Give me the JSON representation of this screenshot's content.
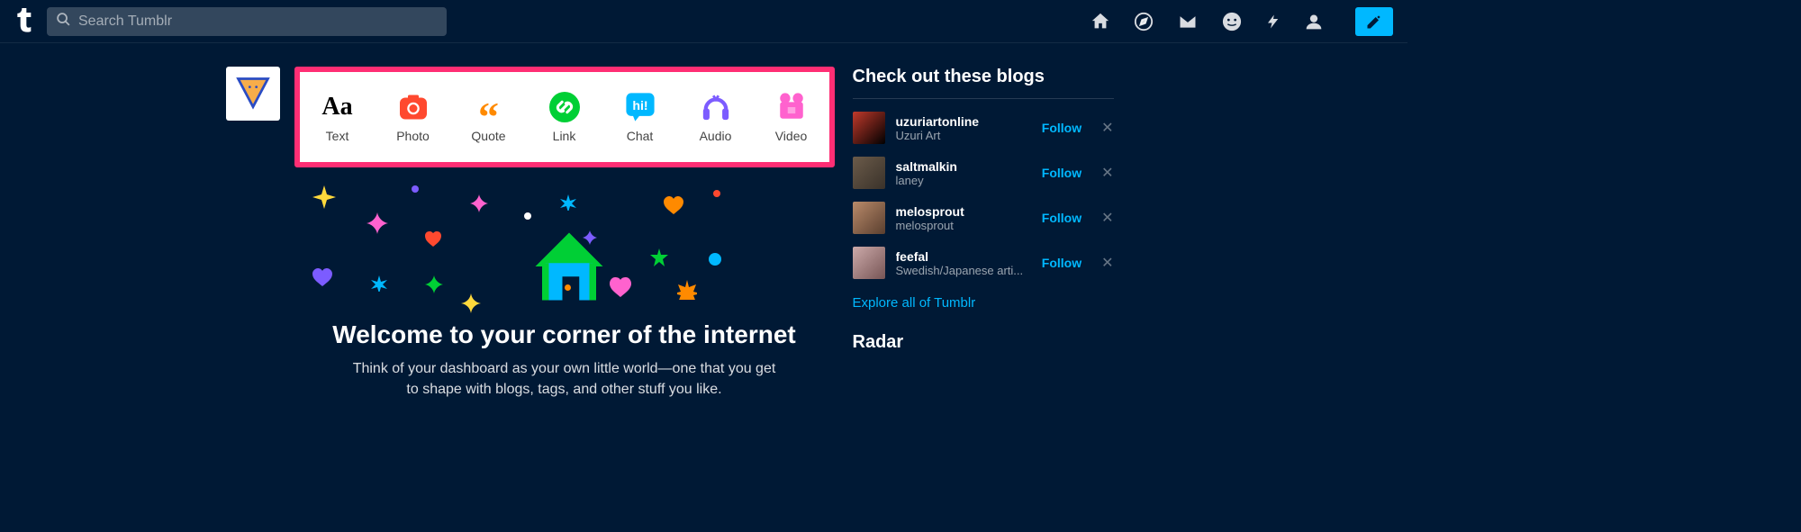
{
  "search": {
    "placeholder": "Search Tumblr"
  },
  "compose": {
    "items": [
      {
        "label": "Text"
      },
      {
        "label": "Photo"
      },
      {
        "label": "Quote"
      },
      {
        "label": "Link"
      },
      {
        "label": "Chat"
      },
      {
        "label": "Audio"
      },
      {
        "label": "Video"
      }
    ]
  },
  "hero": {
    "title": "Welcome to your corner of the internet",
    "subtitle": "Think of your dashboard as your own little world—one that you get to shape with blogs, tags, and other stuff you like."
  },
  "sidebar": {
    "checkout_title": "Check out these blogs",
    "follow_label": "Follow",
    "blogs": [
      {
        "name": "uzuriartonline",
        "sub": "Uzuri Art"
      },
      {
        "name": "saltmalkin",
        "sub": "laney"
      },
      {
        "name": "melosprout",
        "sub": "melosprout"
      },
      {
        "name": "feefal",
        "sub": "Swedish/Japanese arti..."
      }
    ],
    "explore_label": "Explore all of Tumblr",
    "radar_title": "Radar"
  }
}
